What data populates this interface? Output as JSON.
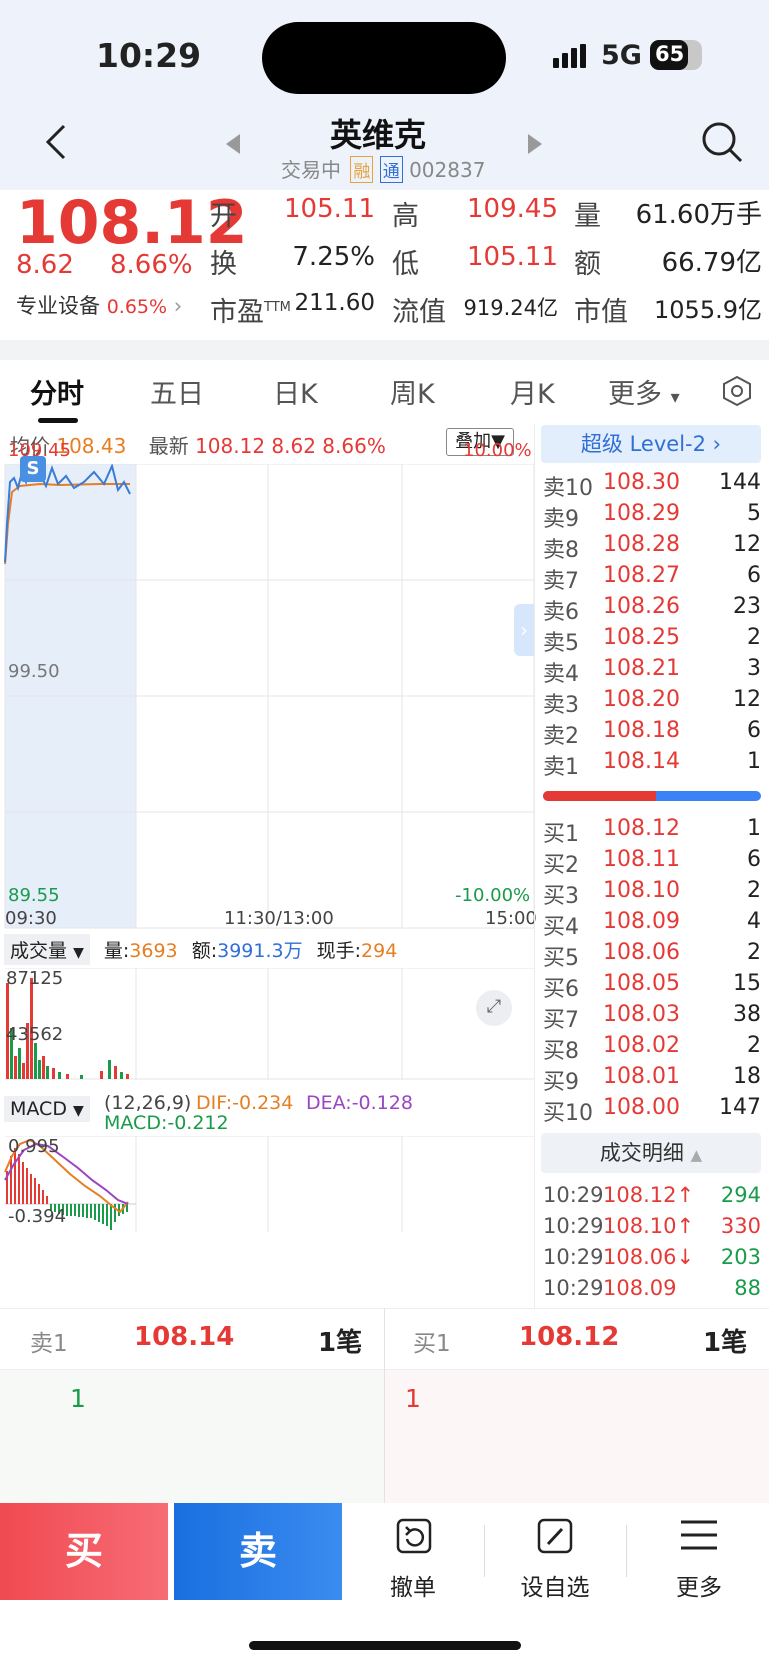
{
  "status_bar": {
    "time": "10:29",
    "network": "5G",
    "battery": "65"
  },
  "header": {
    "stock_name": "英维克",
    "status": "交易中",
    "badge_rong": "融",
    "badge_tong": "通",
    "code": "002837"
  },
  "quote": {
    "price": "108.12",
    "change": "8.62",
    "change_pct": "8.66%",
    "sector": "专业设备",
    "sector_pct": "0.65%",
    "open_label": "开",
    "open": "105.11",
    "high_label": "高",
    "high": "109.45",
    "volume_label": "量",
    "volume": "61.60万手",
    "turnover_label": "换",
    "turnover": "7.25%",
    "low_label": "低",
    "low": "105.11",
    "amount_label": "额",
    "amount": "66.79亿",
    "pe_label": "市盈",
    "pe_sup": "TTM",
    "pe": "211.60",
    "float_label": "流值",
    "float": "919.24亿",
    "cap_label": "市值",
    "cap": "1055.9亿"
  },
  "tabs": [
    "分时",
    "五日",
    "日K",
    "周K",
    "月K",
    "更多"
  ],
  "chart": {
    "avg_label": "均价",
    "avg": "108.43",
    "latest_label": "最新",
    "latest": "108.12",
    "latest_change": "8.62",
    "latest_pct": "8.66%",
    "overlay_btn": "叠加",
    "y_top": "109.45",
    "y_mid": "99.50",
    "y_bottom": "89.55",
    "pct_top": "10.00%",
    "pct_bottom": "-10.00%",
    "x_start": "09:30",
    "x_mid": "11:30/13:00",
    "x_end": "15:00",
    "s_marker": "S",
    "vol_btn": "成交量",
    "vol_label": "量:",
    "vol_val": "3693",
    "amt_label": "额:",
    "amt_val": "3991.3万",
    "hand_label": "现手:",
    "hand_val": "294",
    "vol_top": "87125",
    "vol_mid": "43562",
    "macd_btn": "MACD",
    "macd_params": "(12,26,9)",
    "dif": "DIF:-0.234",
    "dea": "DEA:-0.128",
    "macd": "MACD:-0.212",
    "macd_top": "0.995",
    "macd_bottom": "-0.394"
  },
  "level2_btn": "超级 Level-2",
  "sell_orders": [
    {
      "label": "卖10",
      "price": "108.30",
      "vol": "144"
    },
    {
      "label": "卖9",
      "price": "108.29",
      "vol": "5"
    },
    {
      "label": "卖8",
      "price": "108.28",
      "vol": "12"
    },
    {
      "label": "卖7",
      "price": "108.27",
      "vol": "6"
    },
    {
      "label": "卖6",
      "price": "108.26",
      "vol": "23"
    },
    {
      "label": "卖5",
      "price": "108.25",
      "vol": "2"
    },
    {
      "label": "卖4",
      "price": "108.21",
      "vol": "3"
    },
    {
      "label": "卖3",
      "price": "108.20",
      "vol": "12"
    },
    {
      "label": "卖2",
      "price": "108.18",
      "vol": "6"
    },
    {
      "label": "卖1",
      "price": "108.14",
      "vol": "1"
    }
  ],
  "buy_orders": [
    {
      "label": "买1",
      "price": "108.12",
      "vol": "1"
    },
    {
      "label": "买2",
      "price": "108.11",
      "vol": "6"
    },
    {
      "label": "买3",
      "price": "108.10",
      "vol": "2"
    },
    {
      "label": "买4",
      "price": "108.09",
      "vol": "4"
    },
    {
      "label": "买5",
      "price": "108.06",
      "vol": "2"
    },
    {
      "label": "买6",
      "price": "108.05",
      "vol": "15"
    },
    {
      "label": "买7",
      "price": "108.03",
      "vol": "38"
    },
    {
      "label": "买8",
      "price": "108.02",
      "vol": "2"
    },
    {
      "label": "买9",
      "price": "108.01",
      "vol": "18"
    },
    {
      "label": "买10",
      "price": "108.00",
      "vol": "147"
    }
  ],
  "trade_detail_btn": "成交明细",
  "trades": [
    {
      "time": "10:29",
      "price": "108.12↑",
      "vol": "294",
      "dir": "up"
    },
    {
      "time": "10:29",
      "price": "108.10↑",
      "vol": "330",
      "dir": "up"
    },
    {
      "time": "10:29",
      "price": "108.06↓",
      "vol": "203",
      "dir": "down"
    },
    {
      "time": "10:29",
      "price": "108.09",
      "vol": "88",
      "dir": "flat"
    }
  ],
  "queue": {
    "sell1_label": "卖1",
    "sell1_price": "108.14",
    "sell1_count": "1笔",
    "sell1_item": "1",
    "buy1_label": "买1",
    "buy1_price": "108.12",
    "buy1_count": "1笔",
    "buy1_item": "1"
  },
  "actions": {
    "buy": "买",
    "sell": "卖",
    "cancel": "撤单",
    "watch": "设自选",
    "more": "更多"
  },
  "colors": {
    "up": "#e53935",
    "down": "#1a9b4b",
    "buy_btn": "#f05a61",
    "sell_btn": "#1f7ae0"
  }
}
